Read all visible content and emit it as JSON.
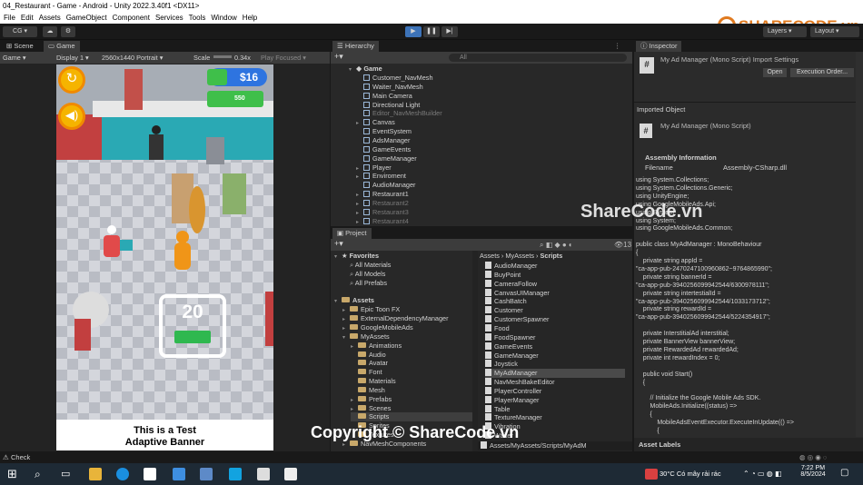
{
  "window": {
    "title": "04_Restaurant - Game - Android - Unity 2022.3.40f1 <DX11>"
  },
  "menu": [
    "File",
    "Edit",
    "Assets",
    "GameObject",
    "Component",
    "Services",
    "Tools",
    "Window",
    "Help"
  ],
  "toolbar": {
    "account": "CG",
    "layers": "Layers",
    "layout": "Layout"
  },
  "brand": {
    "logo_text": "SHARECODE.vn",
    "watermark_mid": "ShareCode.vn",
    "watermark_bottom": "Copyright © ShareCode.vn",
    "accent": "#e07a1f"
  },
  "scene_tabs": [
    "Scene",
    "Game"
  ],
  "game_toolbar": {
    "mode": "Game",
    "display": "Display 1",
    "resolution": "2560x1440 Portrait",
    "scale_label": "Scale",
    "scale_value": "0.34x",
    "play_mode": "Play Focused"
  },
  "game_view": {
    "money": "$16",
    "upgrade_price": "550",
    "order_count": "20",
    "banner_line1": "This is a Test",
    "banner_line2": "Adaptive Banner"
  },
  "hierarchy": {
    "tab": "Hierarchy",
    "search_placeholder": "All",
    "root": "Game",
    "items": [
      "Customer_NavMesh",
      "Waiter_NavMesh",
      "Main Camera",
      "Directional Light",
      "Editor_NavMeshBuilder",
      "Canvas",
      "EventSystem",
      "AdsManager",
      "GameEvents",
      "GameManager",
      "Player",
      "Enviroment",
      "AudioManager",
      "Restaurant1",
      "Restaurant2",
      "Restaurant3",
      "Restaurant4"
    ]
  },
  "project": {
    "tab": "Project",
    "badge": "13",
    "favorites": {
      "label": "Favorites",
      "items": [
        "All Materials",
        "All Models",
        "All Prefabs"
      ]
    },
    "assets": {
      "label": "Assets",
      "items": [
        "Epic Toon FX",
        "ExternalDependencyManager",
        "GoogleMobileAds",
        "MyAssets"
      ]
    },
    "myassets_children": [
      "Animations",
      "Audio",
      "Avatar",
      "Font",
      "Materials",
      "Mesh",
      "Prefabs",
      "Scenes",
      "Scripts",
      "Sprites",
      "Textures"
    ],
    "more": [
      "NavMeshComponents"
    ],
    "breadcrumb": [
      "Assets",
      "MyAssets",
      "Scripts"
    ],
    "scripts": [
      "AudioManager",
      "BuyPoint",
      "CameraFollow",
      "CanvasUIManager",
      "CashBatch",
      "Customer",
      "CustomerSpawner",
      "Food",
      "FoodSpawner",
      "GameEvents",
      "GameManager",
      "Joystick",
      "MyAdManager",
      "NavMeshBakeEditor",
      "PlayerController",
      "PlayerManager",
      "Table",
      "TextureManager",
      "Vibration",
      "Waiter"
    ],
    "selected_script": "MyAdManager",
    "path": "Assets/MyAssets/Scripts/MyAdM"
  },
  "inspector": {
    "tab": "Inspector",
    "title": "My Ad Manager (Mono Script) Import Settings",
    "open_btn": "Open",
    "exec_btn": "Execution Order...",
    "imported_object": "Imported Object",
    "object_name": "My Ad Manager (Mono Script)",
    "assembly_header": "Assembly Information",
    "filename_label": "Filename",
    "filename_value": "Assembly-CSharp.dll",
    "code": [
      "using System.Collections;",
      "using System.Collections.Generic;",
      "using UnityEngine;",
      "using GoogleMobileAds.Api;",
      "using System;",
      "using System;",
      "using GoogleMobileAds.Common;",
      "",
      "public class MyAdManager : MonoBehaviour",
      "{",
      "    private string appId =",
      "\"ca-app-pub-2470247100960862~9764865990\";",
      "    private string bannerId =",
      "\"ca-app-pub-3940256099942544/6300978111\";",
      "    private string intertestialId =",
      "\"ca-app-pub-3940256099942544/1033173712\";",
      "    private string rewardId =",
      "\"ca-app-pub-3940256099942544/5224354917\";",
      "",
      "    private InterstitialAd interstitial;",
      "    private BannerView bannerView;",
      "    private RewardedAd rewardedAd;",
      "    private int rewardIndex = 0;",
      "",
      "    public void Start()",
      "    {",
      "",
      "        // Initialize the Google Mobile Ads SDK.",
      "        MobileAds.Initialize((status) =>",
      "        {",
      "            MobileAdsEventExecutor.ExecuteInUpdate(() =>",
      "            {"
    ],
    "asset_labels": "Asset Labels"
  },
  "status": {
    "check": "Check"
  },
  "taskbar": {
    "weather": "30°C  Có mây rải rác",
    "time": "7:22 PM",
    "date": "8/5/2024"
  }
}
